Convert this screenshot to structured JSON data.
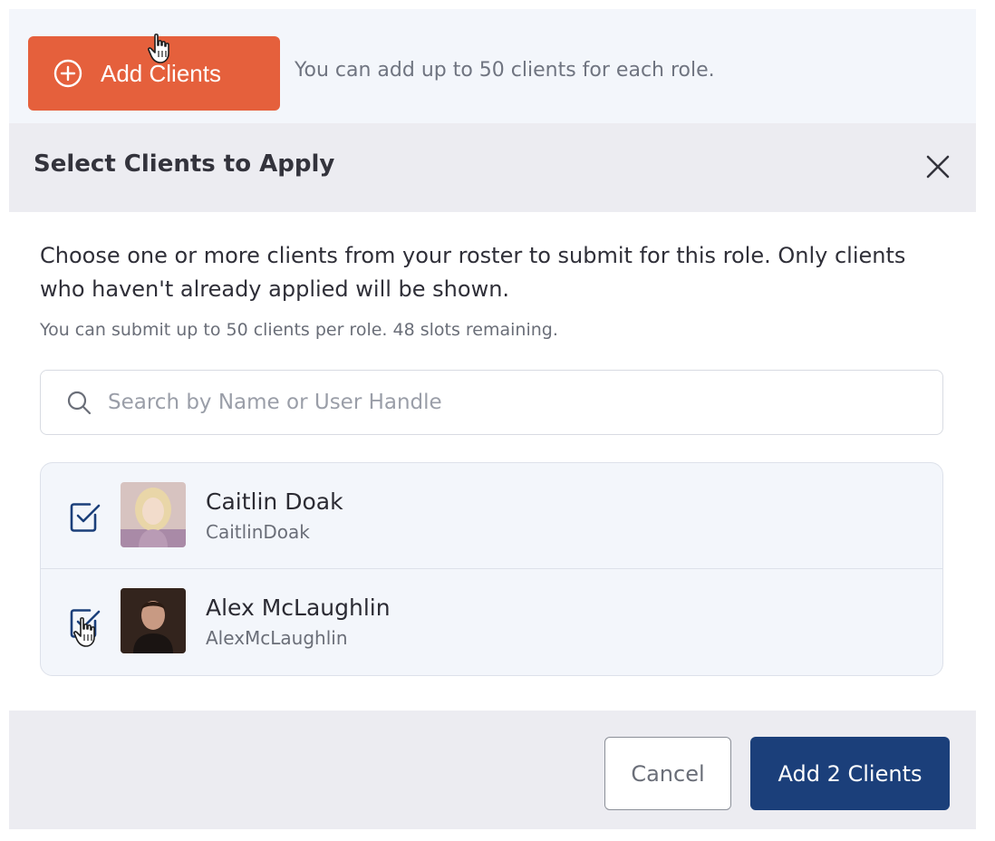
{
  "topbar": {
    "add_button_label": "Add Clients",
    "add_button_icon": "plus-circle-icon",
    "note": "You can add up to 50 clients for each role."
  },
  "modal": {
    "title": "Select Clients to Apply",
    "close_icon": "close-icon",
    "description": "Choose one or more clients from your roster to submit for this role. Only clients who haven't already applied will be shown.",
    "quota_note": "You can submit up to 50 clients per role. 48 slots remaining.",
    "search": {
      "placeholder": "Search by Name or User Handle",
      "value": "",
      "icon": "search-icon"
    },
    "clients": [
      {
        "name": "Caitlin Doak",
        "handle": "CaitlinDoak",
        "checked": true
      },
      {
        "name": "Alex McLaughlin",
        "handle": "AlexMcLaughlin",
        "checked": true
      }
    ],
    "footer": {
      "cancel_label": "Cancel",
      "submit_label": "Add 2 Clients"
    }
  },
  "colors": {
    "accent_orange": "#e5603c",
    "primary_blue": "#1b3f7a",
    "checkbox_blue": "#1b3f7a"
  }
}
